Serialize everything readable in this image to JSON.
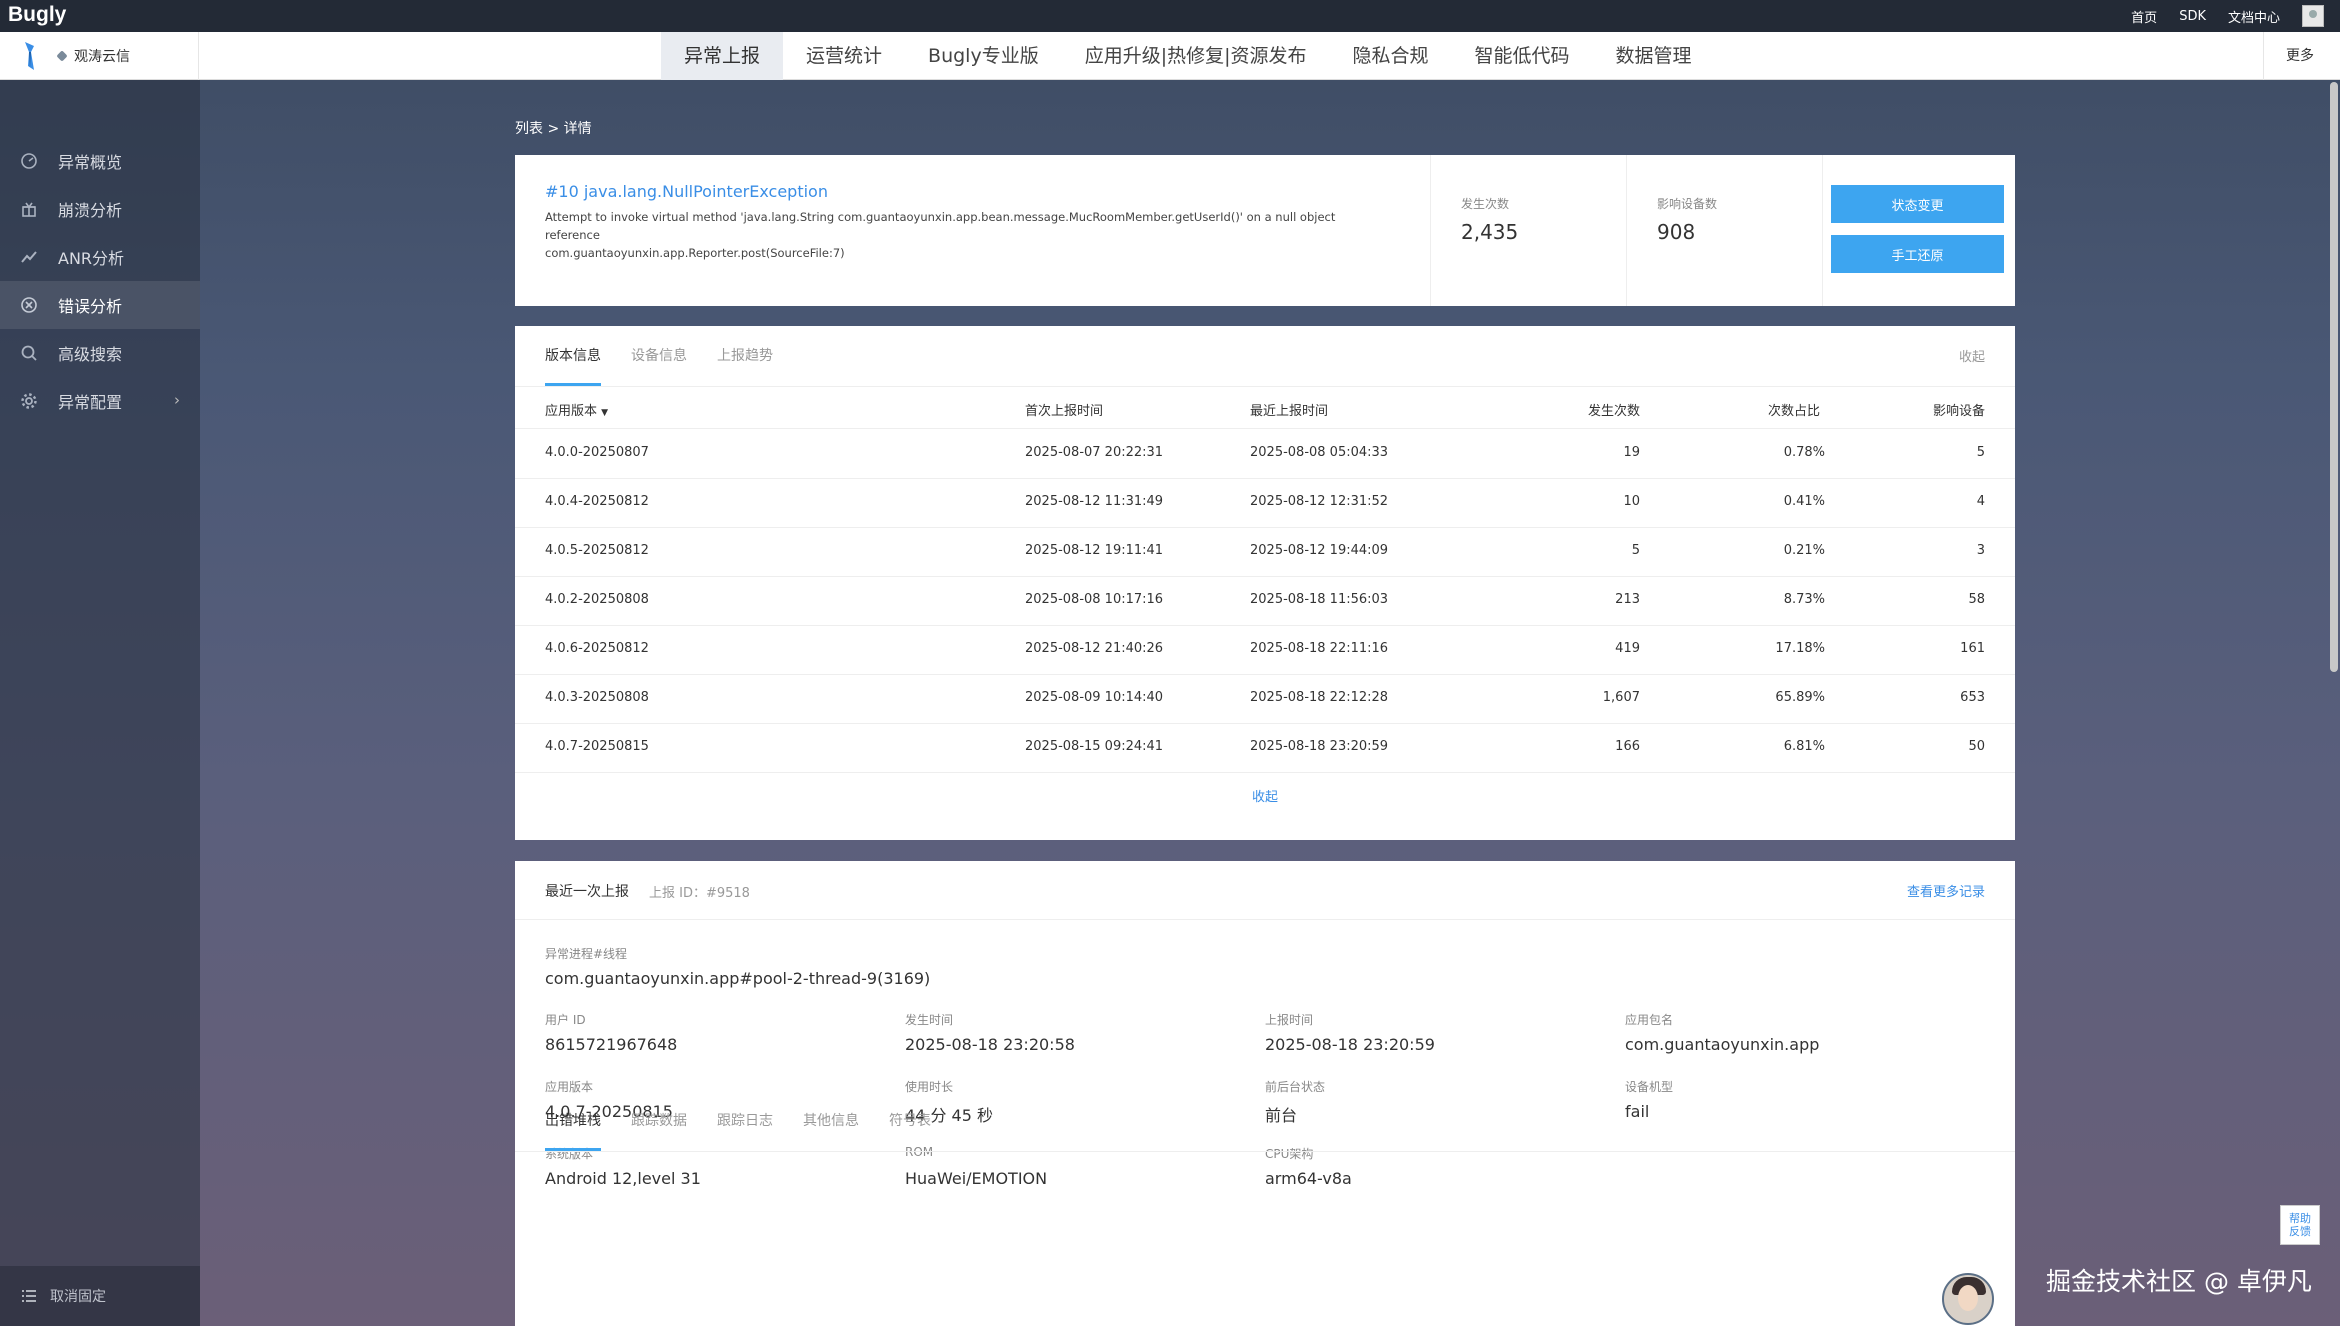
{
  "topbar": {
    "brand": "Bugly",
    "links": [
      "首页",
      "SDK",
      "文档中心"
    ]
  },
  "nav": {
    "app_name": "观涛云信",
    "menu": [
      "异常上报",
      "运营统计",
      "Bugly专业版",
      "应用升级|热修复|资源发布",
      "隐私合规",
      "智能低代码",
      "数据管理"
    ],
    "more": "更多"
  },
  "sidebar": {
    "items": [
      "异常概览",
      "崩溃分析",
      "ANR分析",
      "错误分析",
      "高级搜索",
      "异常配置"
    ],
    "bottom": "取消固定"
  },
  "breadcrumb": "列表 > 详情",
  "error": {
    "title": "#10 java.lang.NullPointerException",
    "desc_line1": "Attempt to invoke virtual method 'java.lang.String com.guantaoyunxin.app.bean.message.MucRoomMember.getUserId()' on a null object reference",
    "desc_line2": "com.guantaoyunxin.app.Reporter.post(SourceFile:7)",
    "count_label": "发生次数",
    "count_value": "2,435",
    "devices_label": "影响设备数",
    "devices_value": "908",
    "btn_status": "状态变更",
    "btn_restore": "手工还原"
  },
  "version": {
    "tabs": [
      "版本信息",
      "设备信息",
      "上报趋势"
    ],
    "collapse": "收起",
    "headers": [
      "应用版本",
      "首次上报时间",
      "最近上报时间",
      "发生次数",
      "次数占比",
      "影响设备"
    ],
    "rows": [
      [
        "4.0.0-20250807",
        "2025-08-07 20:22:31",
        "2025-08-08 05:04:33",
        "19",
        "0.78%",
        "5"
      ],
      [
        "4.0.4-20250812",
        "2025-08-12 11:31:49",
        "2025-08-12 12:31:52",
        "10",
        "0.41%",
        "4"
      ],
      [
        "4.0.5-20250812",
        "2025-08-12 19:11:41",
        "2025-08-12 19:44:09",
        "5",
        "0.21%",
        "3"
      ],
      [
        "4.0.2-20250808",
        "2025-08-08 10:17:16",
        "2025-08-18 11:56:03",
        "213",
        "8.73%",
        "58"
      ],
      [
        "4.0.6-20250812",
        "2025-08-12 21:40:26",
        "2025-08-18 22:11:16",
        "419",
        "17.18%",
        "161"
      ],
      [
        "4.0.3-20250808",
        "2025-08-09 10:14:40",
        "2025-08-18 22:12:28",
        "1,607",
        "65.89%",
        "653"
      ],
      [
        "4.0.7-20250815",
        "2025-08-15 09:24:41",
        "2025-08-18 23:20:59",
        "166",
        "6.81%",
        "50"
      ]
    ],
    "collapse_bottom": "收起"
  },
  "last_report": {
    "title": "最近一次上报",
    "report_id": "上报 ID：#9518",
    "more": "查看更多记录",
    "thread_label": "异常进程#线程",
    "thread_value": "com.guantaoyunxin.app#pool-2-thread-9(3169)",
    "fields": [
      {
        "label": "用户 ID",
        "value": "8615721967648"
      },
      {
        "label": "发生时间",
        "value": "2025-08-18 23:20:58"
      },
      {
        "label": "上报时间",
        "value": "2025-08-18 23:20:59"
      },
      {
        "label": "应用包名",
        "value": "com.guantaoyunxin.app"
      },
      {
        "label": "应用版本",
        "value": "4.0.7-20250815"
      },
      {
        "label": "使用时长",
        "value": "44 分 45 秒"
      },
      {
        "label": "前后台状态",
        "value": "前台"
      },
      {
        "label": "设备机型",
        "value": "fail"
      },
      {
        "label": "系统版本",
        "value": "Android 12,level 31"
      },
      {
        "label": "ROM",
        "value": "HuaWei/EMOTION"
      },
      {
        "label": "CPU架构",
        "value": "arm64-v8a"
      }
    ],
    "tabs": [
      "出错堆栈",
      "跟踪数据",
      "跟踪日志",
      "其他信息",
      "符号表"
    ]
  },
  "help": {
    "line1": "帮助",
    "line2": "反馈"
  },
  "watermark": "掘金技术社区 @ 卓伊凡"
}
